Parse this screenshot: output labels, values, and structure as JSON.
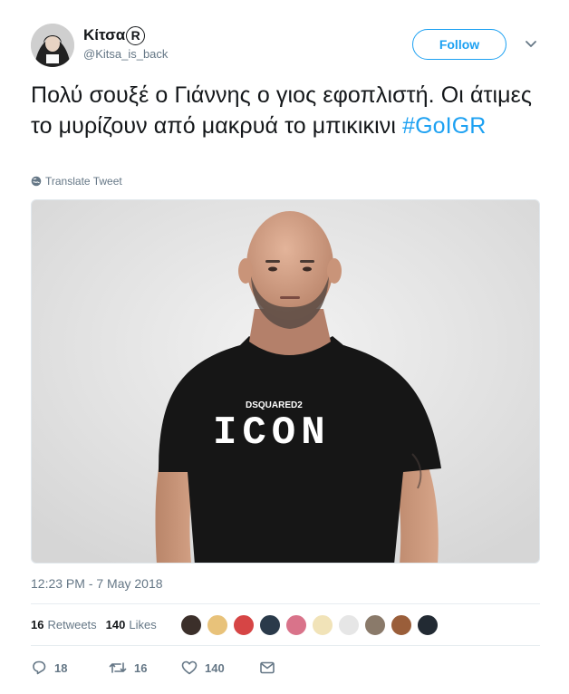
{
  "user": {
    "display_name": "Κίτσα",
    "badge": "R",
    "username": "@Kitsa_is_back",
    "avatar_icon": "avatar-photo"
  },
  "follow_label": "Follow",
  "tweet": {
    "text": "Πολύ σουξέ ο Γιάννης ο γιος εφοπλιστή. Οι άτιμες το μυρίζουν από μακρυά το μπικικινι",
    "hashtag": "#GoIGR"
  },
  "translate_label": "Translate Tweet",
  "media": {
    "shirt_brand": "DSQUARED2",
    "shirt_text": "ICON"
  },
  "timestamp": "12:23 PM - 7 May 2018",
  "stats": {
    "retweets_count": "16",
    "retweets_label": "Retweets",
    "likes_count": "140",
    "likes_label": "Likes"
  },
  "actions": {
    "reply_count": "18",
    "retweet_count": "16",
    "like_count": "140"
  },
  "colors": {
    "accent": "#1da1f2",
    "secondary_text": "#657786",
    "primary_text": "#14171a"
  }
}
